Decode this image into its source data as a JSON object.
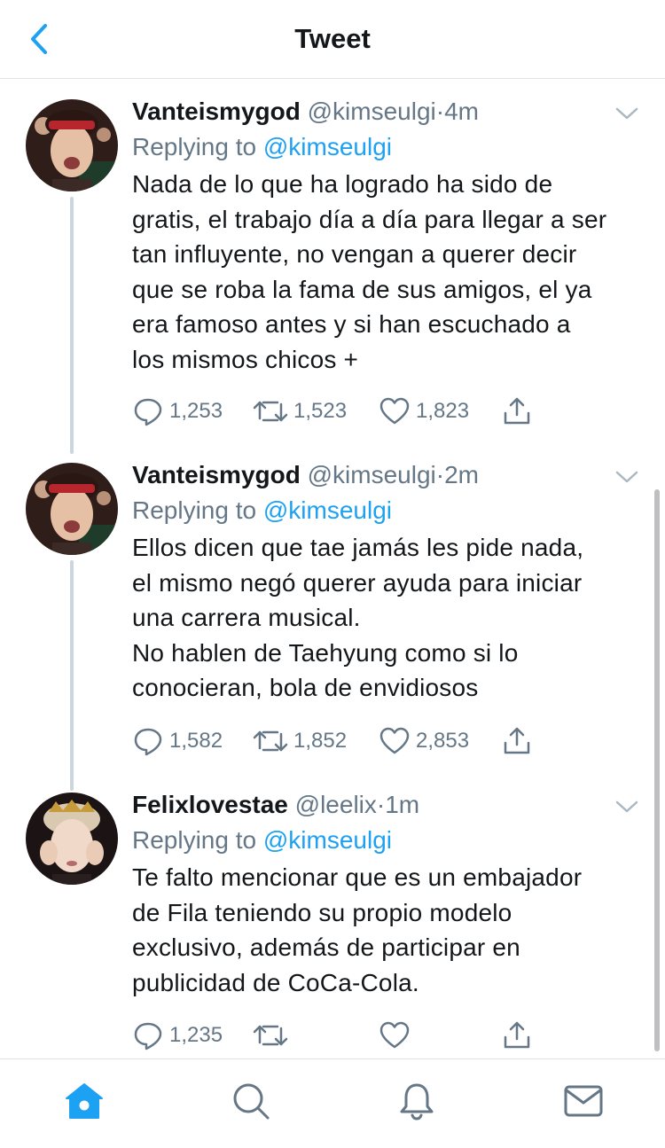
{
  "header": {
    "title": "Tweet",
    "back_icon": "chevron-left-icon"
  },
  "tweets": [
    {
      "display_name": "Vanteismygod",
      "handle": "@kimseulgi",
      "separator": "·",
      "time": "4m",
      "replying_prefix": "Replying to ",
      "replying_to": "@kimseulgi",
      "text": "Nada de lo que ha logrado ha sido de\ngratis, el trabajo día a día para llegar a ser\ntan influyente, no vengan a querer decir\nque se roba la fama de sus amigos, el ya\nera famoso antes y si han escuchado a\nlos mismos chicos +",
      "replies": "1,253",
      "retweets": "1,523",
      "likes": "1,823"
    },
    {
      "display_name": "Vanteismygod",
      "handle": "@kimseulgi",
      "separator": "·",
      "time": "2m",
      "replying_prefix": "Replying to ",
      "replying_to": "@kimseulgi",
      "text": "Ellos dicen que tae jamás les pide nada,\nel mismo negó querer ayuda para iniciar\nuna carrera musical.\nNo hablen de Taehyung como si lo\nconocieran, bola de envidiosos",
      "replies": "1,582",
      "retweets": "1,852",
      "likes": "2,853"
    },
    {
      "display_name": "Felixlovestae",
      "handle": "@leelix",
      "separator": "·",
      "time": "1m",
      "replying_prefix": "Replying to ",
      "replying_to": "@kimseulgi",
      "text": "Te falto mencionar que es un embajador\nde Fila teniendo su propio modelo\nexclusivo, además de participar en\npublicidad de CoCa-Cola.",
      "replies": "1,235",
      "retweets": "",
      "likes": ""
    }
  ],
  "tabbar": {
    "items": [
      "home-icon",
      "search-icon",
      "notifications-icon",
      "messages-icon"
    ],
    "active": "home-icon"
  },
  "colors": {
    "accent": "#1da1f2",
    "secondary_text": "#657786",
    "divider": "#dfe3e8"
  }
}
